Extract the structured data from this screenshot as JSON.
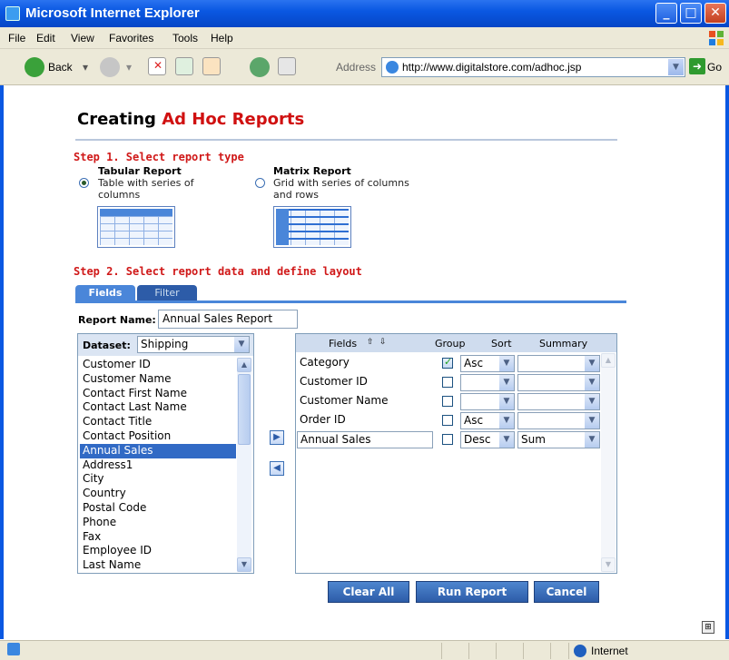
{
  "window": {
    "title": "Microsoft Internet Explorer",
    "minimize": "_",
    "maximize": "□",
    "close": "✕"
  },
  "menu": [
    "File",
    "Edit",
    "View",
    "Favorites",
    "Tools",
    "Help"
  ],
  "toolbar": {
    "back_label": "Back",
    "address_label": "Address",
    "url": "http://www.digitalstore.com/adhoc.jsp",
    "go_label": "Go"
  },
  "page": {
    "title_plain": "Creating ",
    "title_accent": "Ad Hoc Reports",
    "accent_color": "#d01010",
    "step1": "Step 1. Select report type",
    "tabular": {
      "title": "Tabular Report",
      "desc_line1": "Table with series of",
      "desc_line2": "columns"
    },
    "matrix": {
      "title": "Matrix Report",
      "desc_line1": "Grid with series of columns",
      "desc_line2": "and rows"
    },
    "step2": "Step 2. Select report data and define layout",
    "tabs": [
      "Fields",
      "Filter"
    ],
    "report_name_label": "Report Name:",
    "report_name_value": "Annual Sales Report",
    "dataset_label": "Dataset:",
    "dataset_value": "Shipping",
    "dataset_fields": [
      "Customer ID",
      "Customer Name",
      "Contact First Name",
      "Contact Last Name",
      "Contact Title",
      "Contact Position",
      "Annual Sales",
      "Address1",
      "City",
      "Country",
      "Postal Code",
      "Phone",
      "Fax",
      "Employee ID",
      "Last Name"
    ],
    "selected_field": "Annual Sales",
    "grid_headers": {
      "fields": "Fields",
      "group": "Group",
      "sort": "Sort",
      "summary": "Summary"
    },
    "layout_rows": [
      {
        "field": "Category",
        "group": true,
        "sort": "Asc",
        "summary": ""
      },
      {
        "field": "Customer ID",
        "group": false,
        "sort": "",
        "summary": ""
      },
      {
        "field": "Customer Name",
        "group": false,
        "sort": "",
        "summary": ""
      },
      {
        "field": "Order ID",
        "group": false,
        "sort": "Asc",
        "summary": ""
      },
      {
        "field": "Annual Sales",
        "group": false,
        "sort": "Desc",
        "summary": "Sum"
      }
    ],
    "buttons": {
      "clear": "Clear All",
      "run": "Run Report",
      "cancel": "Cancel"
    }
  },
  "status": {
    "zone": "Internet"
  }
}
